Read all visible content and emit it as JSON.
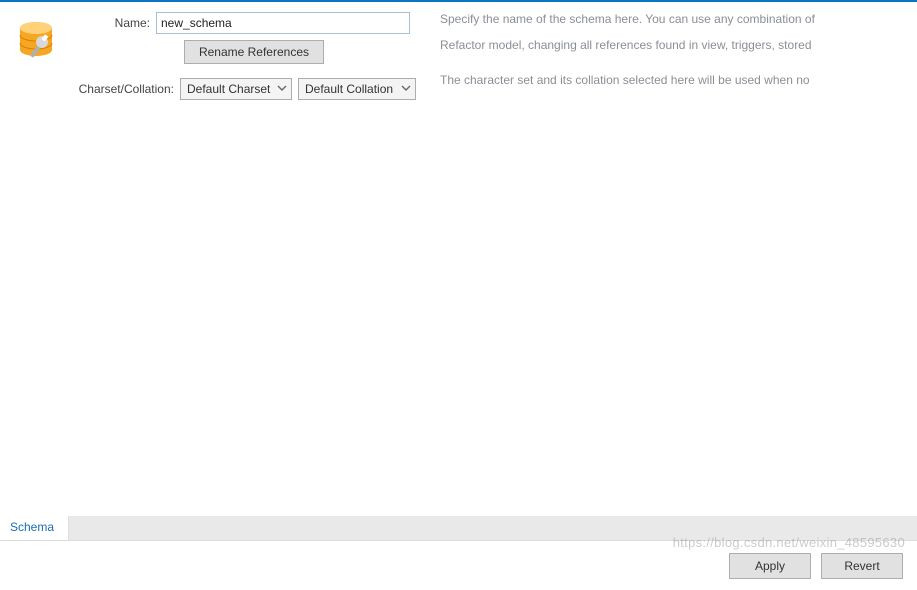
{
  "labels": {
    "name": "Name:",
    "charset_collation": "Charset/Collation:"
  },
  "fields": {
    "name_value": "new_schema",
    "charset_selected": "Default Charset",
    "collation_selected": "Default Collation"
  },
  "buttons": {
    "rename_references": "Rename References",
    "apply": "Apply",
    "revert": "Revert"
  },
  "hints": {
    "name": "Specify the name of the schema here. You can use any combination of",
    "rename": "Refactor model, changing all references found in view, triggers, stored",
    "charset": "The character set and its collation selected here will be used when no"
  },
  "tabs": {
    "schema": "Schema"
  },
  "watermark": "https://blog.csdn.net/weixin_48595630",
  "icon": {
    "name": "schema-icon"
  }
}
